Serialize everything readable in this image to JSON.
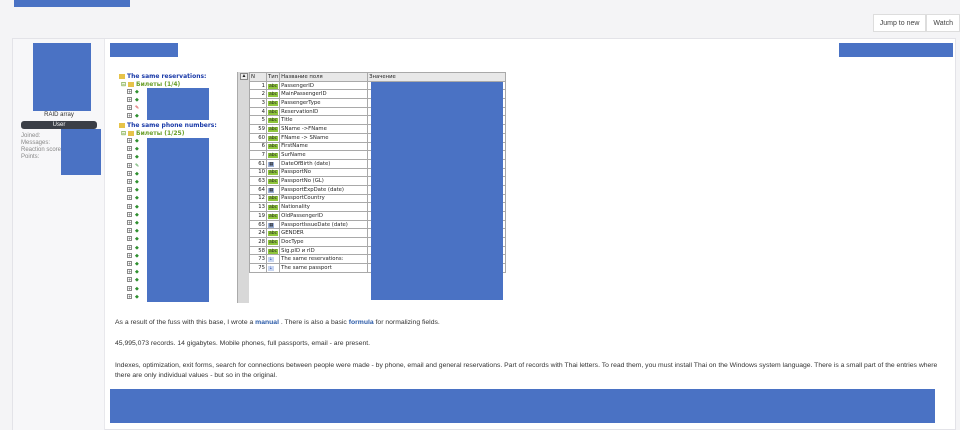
{
  "top_actions": [
    "Jump to new",
    "Watch"
  ],
  "user": {
    "name": "RAID array",
    "badge": "User",
    "stats": [
      "Joined:",
      "Messages:",
      "Reaction score:",
      "Points:"
    ]
  },
  "tree": {
    "heading1": "The same reservations:",
    "group1": "Билеты (1/4)",
    "heading2": "The same phone numbers:",
    "group2": "Билеты (1/25)"
  },
  "grid": {
    "headers": [
      "N",
      "Тип",
      "Название поля",
      "Значение"
    ],
    "rows": [
      {
        "n": "1",
        "type": "abc",
        "name": "PassengerID"
      },
      {
        "n": "2",
        "type": "abc",
        "name": "MainPassengerID"
      },
      {
        "n": "3",
        "type": "abc",
        "name": "PassengerType"
      },
      {
        "n": "4",
        "type": "abc",
        "name": "ReservationID"
      },
      {
        "n": "5",
        "type": "abc",
        "name": "Title"
      },
      {
        "n": "59",
        "type": "abc",
        "name": "SName ->FName"
      },
      {
        "n": "60",
        "type": "abc",
        "name": "FName -> SName"
      },
      {
        "n": "6",
        "type": "abc",
        "name": "FirstName"
      },
      {
        "n": "7",
        "type": "abc",
        "name": "SurName"
      },
      {
        "n": "61",
        "type": "cal",
        "name": "DateOfBirth (date)"
      },
      {
        "n": "10",
        "type": "abc",
        "name": "PassportNo"
      },
      {
        "n": "63",
        "type": "abc",
        "name": "PassportNo (GL)"
      },
      {
        "n": "64",
        "type": "cal",
        "name": "PassportExpDate (date)"
      },
      {
        "n": "12",
        "type": "abc",
        "name": "PassportCountry"
      },
      {
        "n": "13",
        "type": "abc",
        "name": "Nationality"
      },
      {
        "n": "19",
        "type": "abc",
        "name": "OldPassengerID"
      },
      {
        "n": "65",
        "type": "cal",
        "name": "PassportIssueDate (date)"
      },
      {
        "n": "24",
        "type": "abc",
        "name": "GENDER"
      },
      {
        "n": "28",
        "type": "abc",
        "name": "DocType"
      },
      {
        "n": "58",
        "type": "abc",
        "name": "Sig.pID и rID"
      },
      {
        "n": "73",
        "type": "ref",
        "name": "The same reservations:"
      },
      {
        "n": "75",
        "type": "ref",
        "name": "The same passport"
      }
    ]
  },
  "post": {
    "p1_before": "As a result of the fuss with this base, I wrote a ",
    "p1_link1": "manual",
    "p1_mid": " . There is also a basic ",
    "p1_link2": "formula",
    "p1_after": " for normalizing fields.",
    "p2": "45,995,073 records. 14 gigabytes. Mobile phones, full passports, email - are present.",
    "p3": "Indexes, optimization, exit forms, search for connections between people were made - by phone, email and general reservations. Part of records with Thai letters. To read them, you must install Thai on the Windows system language. There is a small part of the entries where there are only individual values - but so in the original."
  },
  "colors": {
    "redaction": "#4a72c4",
    "badge": "#3b3f47",
    "link": "#2a5aa8"
  }
}
